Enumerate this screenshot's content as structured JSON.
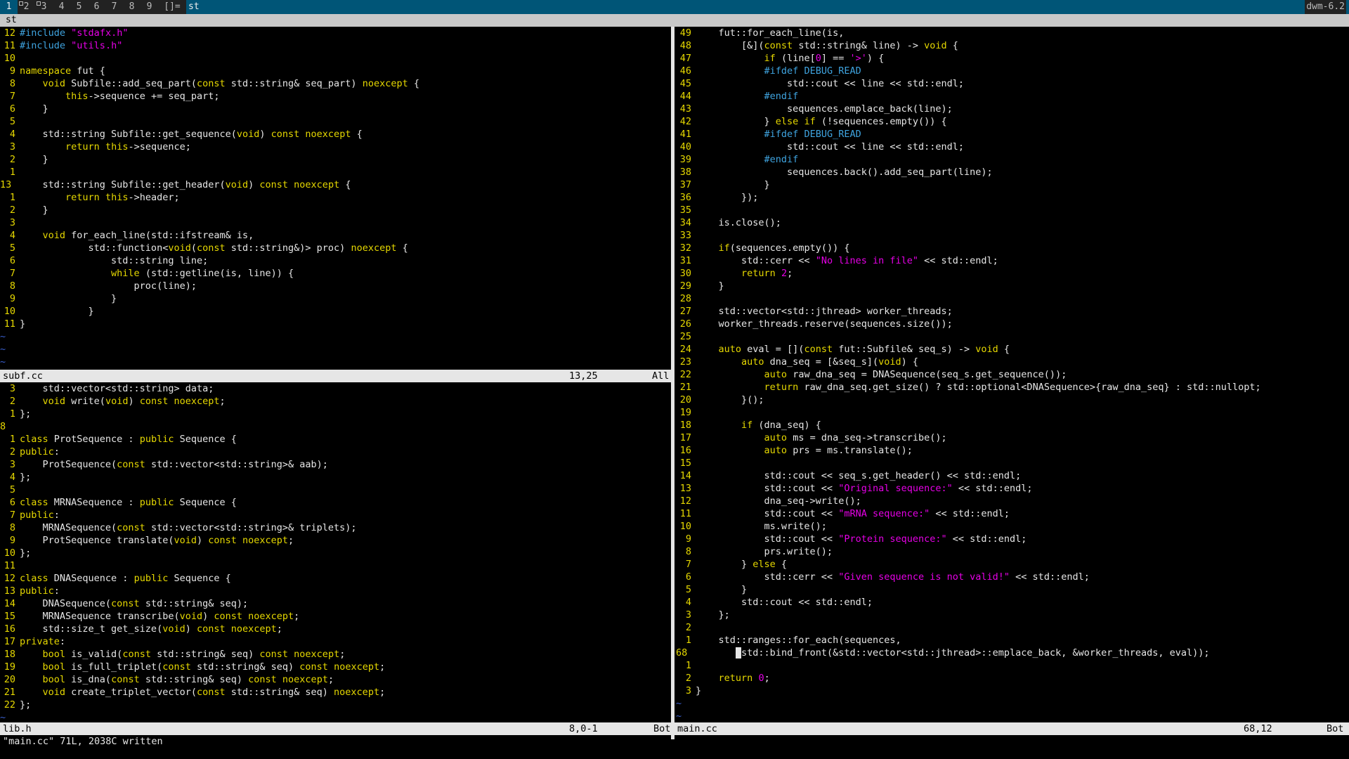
{
  "bar": {
    "tags": [
      {
        "label": "1",
        "selected": true,
        "occupied": false
      },
      {
        "label": "2",
        "selected": false,
        "occupied": true
      },
      {
        "label": "3",
        "selected": false,
        "occupied": true
      },
      {
        "label": "4",
        "selected": false,
        "occupied": false
      },
      {
        "label": "5",
        "selected": false,
        "occupied": false
      },
      {
        "label": "6",
        "selected": false,
        "occupied": false
      },
      {
        "label": "7",
        "selected": false,
        "occupied": false
      },
      {
        "label": "8",
        "selected": false,
        "occupied": false
      },
      {
        "label": "9",
        "selected": false,
        "occupied": false
      }
    ],
    "layout": "[]=",
    "window_title": "st",
    "status": "dwm-6.2"
  },
  "window_bar": "st",
  "panes": {
    "top_left": {
      "filename": "subf.cc",
      "position": "13,25",
      "percent": "All",
      "lines": [
        [
          "12",
          "#include \"stdafx.h\""
        ],
        [
          "11",
          "#include \"utils.h\""
        ],
        [
          "10",
          ""
        ],
        [
          "9",
          "namespace fut {"
        ],
        [
          "8",
          "    void Subfile::add_seq_part(const std::string& seq_part) noexcept {"
        ],
        [
          "7",
          "        this->sequence += seq_part;"
        ],
        [
          "6",
          "    }"
        ],
        [
          "5",
          ""
        ],
        [
          "4",
          "    std::string Subfile::get_sequence(void) const noexcept {"
        ],
        [
          "3",
          "        return this->sequence;"
        ],
        [
          "2",
          "    }"
        ],
        [
          "1",
          ""
        ],
        [
          "13",
          "    std::string Subfile::get_header(void) const noexcept {"
        ],
        [
          "1",
          "        return this->header;"
        ],
        [
          "2",
          "    }"
        ],
        [
          "3",
          ""
        ],
        [
          "4",
          "    void for_each_line(std::ifstream& is,"
        ],
        [
          "5",
          "            std::function<void(const std::string&)> proc) noexcept {"
        ],
        [
          "6",
          "                std::string line;"
        ],
        [
          "7",
          "                while (std::getline(is, line)) {"
        ],
        [
          "8",
          "                    proc(line);"
        ],
        [
          "9",
          "                }"
        ],
        [
          "10",
          "            }"
        ],
        [
          "11",
          "}"
        ],
        [
          "~",
          ""
        ],
        [
          "~",
          ""
        ],
        [
          "~",
          ""
        ]
      ]
    },
    "bottom_left": {
      "filename": "lib.h",
      "position": "8,0-1",
      "percent": "Bot",
      "lines": [
        [
          "3",
          "    std::vector<std::string> data;"
        ],
        [
          "2",
          "    void write(void) const noexcept;"
        ],
        [
          "1",
          "};"
        ],
        [
          "8",
          ""
        ],
        [
          "1",
          "class ProtSequence : public Sequence {"
        ],
        [
          "2",
          "public:"
        ],
        [
          "3",
          "    ProtSequence(const std::vector<std::string>& aab);"
        ],
        [
          "4",
          "};"
        ],
        [
          "5",
          ""
        ],
        [
          "6",
          "class MRNASequence : public Sequence {"
        ],
        [
          "7",
          "public:"
        ],
        [
          "8",
          "    MRNASequence(const std::vector<std::string>& triplets);"
        ],
        [
          "9",
          "    ProtSequence translate(void) const noexcept;"
        ],
        [
          "10",
          "};"
        ],
        [
          "11",
          ""
        ],
        [
          "12",
          "class DNASequence : public Sequence {"
        ],
        [
          "13",
          "public:"
        ],
        [
          "14",
          "    DNASequence(const std::string& seq);"
        ],
        [
          "15",
          "    MRNASequence transcribe(void) const noexcept;"
        ],
        [
          "16",
          "    std::size_t get_size(void) const noexcept;"
        ],
        [
          "17",
          "private:"
        ],
        [
          "18",
          "    bool is_valid(const std::string& seq) const noexcept;"
        ],
        [
          "19",
          "    bool is_full_triplet(const std::string& seq) const noexcept;"
        ],
        [
          "20",
          "    bool is_dna(const std::string& seq) const noexcept;"
        ],
        [
          "21",
          "    void create_triplet_vector(const std::string& seq) noexcept;"
        ],
        [
          "22",
          "};"
        ],
        [
          "~",
          ""
        ]
      ]
    },
    "right": {
      "filename": "main.cc",
      "position": "68,12",
      "percent": "Bot",
      "lines": [
        [
          "49",
          "    fut::for_each_line(is,"
        ],
        [
          "48",
          "        [&](const std::string& line) -> void {"
        ],
        [
          "47",
          "            if (line[0] == '>') {"
        ],
        [
          "46",
          "            #ifdef DEBUG_READ"
        ],
        [
          "45",
          "                std::cout << line << std::endl;"
        ],
        [
          "44",
          "            #endif"
        ],
        [
          "43",
          "                sequences.emplace_back(line);"
        ],
        [
          "42",
          "            } else if (!sequences.empty()) {"
        ],
        [
          "41",
          "            #ifdef DEBUG_READ"
        ],
        [
          "40",
          "                std::cout << line << std::endl;"
        ],
        [
          "39",
          "            #endif"
        ],
        [
          "38",
          "                sequences.back().add_seq_part(line);"
        ],
        [
          "37",
          "            }"
        ],
        [
          "36",
          "        });"
        ],
        [
          "35",
          ""
        ],
        [
          "34",
          "    is.close();"
        ],
        [
          "33",
          ""
        ],
        [
          "32",
          "    if(sequences.empty()) {"
        ],
        [
          "31",
          "        std::cerr << \"No lines in file\" << std::endl;"
        ],
        [
          "30",
          "        return 2;"
        ],
        [
          "29",
          "    }"
        ],
        [
          "28",
          ""
        ],
        [
          "27",
          "    std::vector<std::jthread> worker_threads;"
        ],
        [
          "26",
          "    worker_threads.reserve(sequences.size());"
        ],
        [
          "25",
          ""
        ],
        [
          "24",
          "    auto eval = [](const fut::Subfile& seq_s) -> void {"
        ],
        [
          "23",
          "        auto dna_seq = [&seq_s](void) {"
        ],
        [
          "22",
          "            auto raw_dna_seq = DNASequence(seq_s.get_sequence());"
        ],
        [
          "21",
          "            return raw_dna_seq.get_size() ? std::optional<DNASequence>{raw_dna_seq} : std::nullopt;"
        ],
        [
          "20",
          "        }();"
        ],
        [
          "19",
          ""
        ],
        [
          "18",
          "        if (dna_seq) {"
        ],
        [
          "17",
          "            auto ms = dna_seq->transcribe();"
        ],
        [
          "16",
          "            auto prs = ms.translate();"
        ],
        [
          "15",
          ""
        ],
        [
          "14",
          "            std::cout << seq_s.get_header() << std::endl;"
        ],
        [
          "13",
          "            std::cout << \"Original sequence:\" << std::endl;"
        ],
        [
          "12",
          "            dna_seq->write();"
        ],
        [
          "11",
          "            std::cout << \"mRNA sequence:\" << std::endl;"
        ],
        [
          "10",
          "            ms.write();"
        ],
        [
          "9",
          "            std::cout << \"Protein sequence:\" << std::endl;"
        ],
        [
          "8",
          "            prs.write();"
        ],
        [
          "7",
          "        } else {"
        ],
        [
          "6",
          "            std::cerr << \"Given sequence is not valid!\" << std::endl;"
        ],
        [
          "5",
          "        }"
        ],
        [
          "4",
          "        std::cout << std::endl;"
        ],
        [
          "3",
          "    };"
        ],
        [
          "2",
          ""
        ],
        [
          "1",
          "    std::ranges::for_each(sequences,"
        ],
        [
          "68",
          "        std::bind_front(&std::vector<std::jthread>::emplace_back, &worker_threads, eval));"
        ],
        [
          "1",
          ""
        ],
        [
          "2",
          "    return 0;"
        ],
        [
          "3",
          "}"
        ],
        [
          "~",
          ""
        ],
        [
          "~",
          ""
        ]
      ]
    }
  },
  "command_line": "\"main.cc\" 71L, 2038C written"
}
